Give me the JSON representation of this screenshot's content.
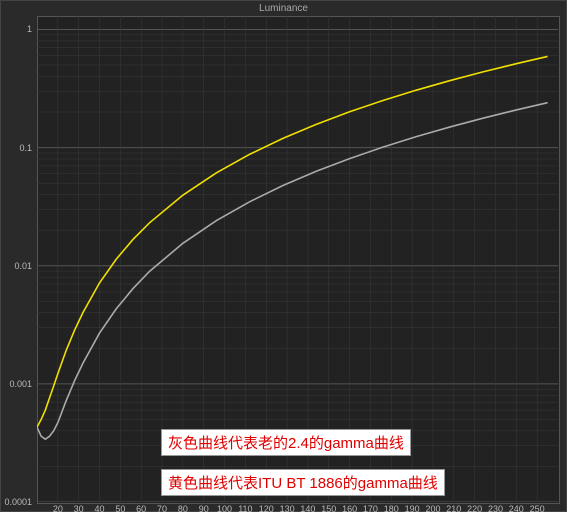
{
  "title": "Luminance",
  "chart_data": {
    "type": "line",
    "xlabel": "",
    "ylabel": "",
    "x_range": [
      10,
      260
    ],
    "y_range_log": [
      0.0001,
      1.3
    ],
    "x_ticks": [
      20,
      30,
      40,
      50,
      60,
      70,
      80,
      90,
      100,
      110,
      120,
      130,
      140,
      150,
      160,
      170,
      180,
      190,
      200,
      210,
      220,
      230,
      240,
      250
    ],
    "y_ticks": [
      0.0001,
      0.001,
      0.01,
      0.1,
      1
    ],
    "series": [
      {
        "name": "Gamma 2.4 (gray)",
        "color": "#aaaaaa",
        "x": [
          10,
          12,
          14,
          16,
          18,
          20,
          24,
          28,
          32,
          40,
          48,
          56,
          64,
          80,
          96,
          112,
          128,
          144,
          160,
          176,
          192,
          208,
          224,
          240,
          255
        ],
        "y": [
          0.00043,
          0.00036,
          0.00034,
          0.00036,
          0.0004,
          0.00047,
          0.00072,
          0.00106,
          0.00149,
          0.00269,
          0.00431,
          0.00639,
          0.00896,
          0.01549,
          0.02406,
          0.03477,
          0.04773,
          0.06303,
          0.08075,
          0.10097,
          0.12377,
          0.14922,
          0.1774,
          0.20837,
          0.24
        ]
      },
      {
        "name": "ITU BT.1886 (yellow)",
        "color": "#f0e000",
        "x": [
          10,
          12,
          14,
          16,
          18,
          20,
          24,
          28,
          32,
          40,
          48,
          56,
          64,
          80,
          96,
          112,
          128,
          144,
          160,
          176,
          192,
          208,
          224,
          240,
          255
        ],
        "y": [
          0.00043,
          0.0005,
          0.0006,
          0.00076,
          0.00096,
          0.00122,
          0.00192,
          0.00284,
          0.004,
          0.00716,
          0.01135,
          0.01665,
          0.02309,
          0.03957,
          0.06101,
          0.08765,
          0.1197,
          0.15738,
          0.2009,
          0.25046,
          0.30627,
          0.3685,
          0.43736,
          0.51302,
          0.591
        ]
      }
    ]
  },
  "annotations": {
    "gray": "灰色曲线代表老的2.4的gamma曲线",
    "yellow": "黄色曲线代表ITU BT 1886的gamma曲线"
  }
}
